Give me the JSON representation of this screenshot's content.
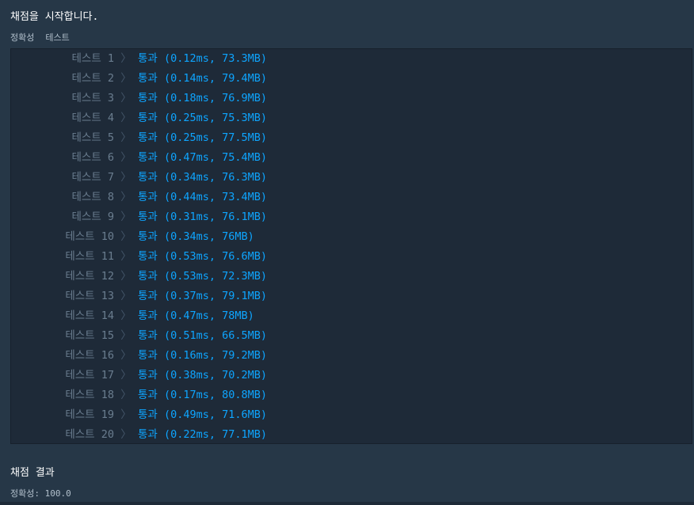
{
  "header": {
    "title": "채점을 시작합니다."
  },
  "section": {
    "label": "정확성",
    "suite": "테스트"
  },
  "results": [
    {
      "name": "테스트 1",
      "status": "통과",
      "detail": "(0.12ms, 73.3MB)"
    },
    {
      "name": "테스트 2",
      "status": "통과",
      "detail": "(0.14ms, 79.4MB)"
    },
    {
      "name": "테스트 3",
      "status": "통과",
      "detail": "(0.18ms, 76.9MB)"
    },
    {
      "name": "테스트 4",
      "status": "통과",
      "detail": "(0.25ms, 75.3MB)"
    },
    {
      "name": "테스트 5",
      "status": "통과",
      "detail": "(0.25ms, 77.5MB)"
    },
    {
      "name": "테스트 6",
      "status": "통과",
      "detail": "(0.47ms, 75.4MB)"
    },
    {
      "name": "테스트 7",
      "status": "통과",
      "detail": "(0.34ms, 76.3MB)"
    },
    {
      "name": "테스트 8",
      "status": "통과",
      "detail": "(0.44ms, 73.4MB)"
    },
    {
      "name": "테스트 9",
      "status": "통과",
      "detail": "(0.31ms, 76.1MB)"
    },
    {
      "name": "테스트 10",
      "status": "통과",
      "detail": "(0.34ms, 76MB)"
    },
    {
      "name": "테스트 11",
      "status": "통과",
      "detail": "(0.53ms, 76.6MB)"
    },
    {
      "name": "테스트 12",
      "status": "통과",
      "detail": "(0.53ms, 72.3MB)"
    },
    {
      "name": "테스트 13",
      "status": "통과",
      "detail": "(0.37ms, 79.1MB)"
    },
    {
      "name": "테스트 14",
      "status": "통과",
      "detail": "(0.47ms, 78MB)"
    },
    {
      "name": "테스트 15",
      "status": "통과",
      "detail": "(0.51ms, 66.5MB)"
    },
    {
      "name": "테스트 16",
      "status": "통과",
      "detail": "(0.16ms, 79.2MB)"
    },
    {
      "name": "테스트 17",
      "status": "통과",
      "detail": "(0.38ms, 70.2MB)"
    },
    {
      "name": "테스트 18",
      "status": "통과",
      "detail": "(0.17ms, 80.8MB)"
    },
    {
      "name": "테스트 19",
      "status": "통과",
      "detail": "(0.49ms, 71.6MB)"
    },
    {
      "name": "테스트 20",
      "status": "통과",
      "detail": "(0.22ms, 77.1MB)"
    }
  ],
  "footer": {
    "title": "채점 결과",
    "accuracy": "정확성: 100.0"
  },
  "icons": {
    "row_separator": "chevron-right-icon"
  },
  "colors": {
    "pass": "#0ea5ff",
    "background": "#263747",
    "panel": "#1e2a38"
  }
}
